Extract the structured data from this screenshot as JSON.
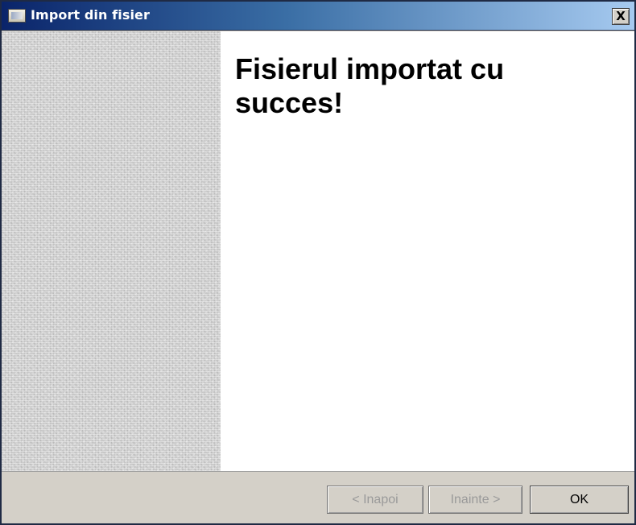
{
  "window": {
    "title": "Import din fisier",
    "close_label": "X"
  },
  "main": {
    "heading": "Fisierul importat cu succes!"
  },
  "footer": {
    "back_label": "< Inapoi",
    "next_label": "Inainte >",
    "ok_label": "OK"
  },
  "icons": {
    "app": "app-window-icon",
    "close": "close-icon"
  },
  "colors": {
    "titlebar_start": "#0a246a",
    "titlebar_end": "#a6caf0",
    "dialog_face": "#d4d0c8"
  }
}
